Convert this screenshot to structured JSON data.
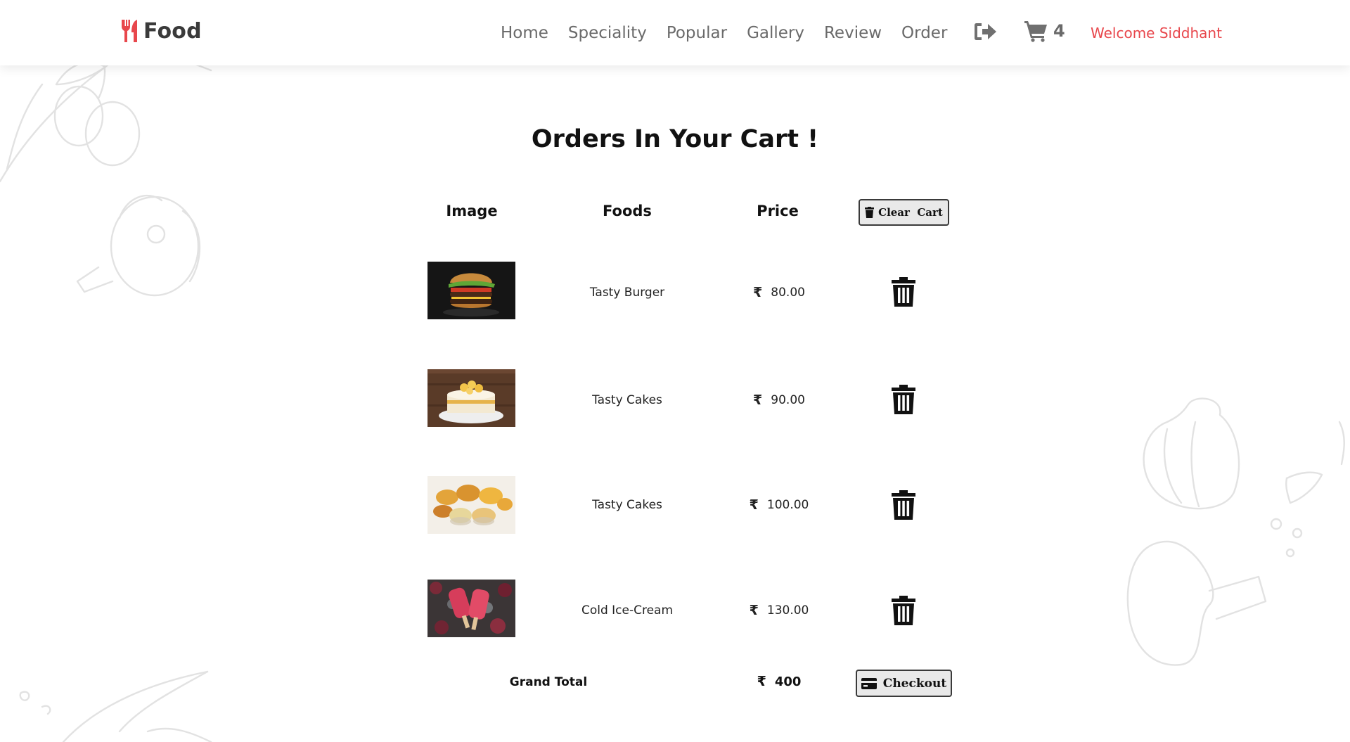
{
  "header": {
    "brand": "Food",
    "brand_icon": "utensils-icon",
    "brand_color": "#e8474c",
    "nav": [
      "Home",
      "Speciality",
      "Popular",
      "Gallery",
      "Review",
      "Order"
    ],
    "logout_icon": "sign-out-icon",
    "cart_icon": "shopping-cart-icon",
    "cart_count": "4",
    "welcome": "Welcome Siddhant"
  },
  "page": {
    "title": "Orders In Your Cart !"
  },
  "table": {
    "headers": [
      "Image",
      "Foods",
      "Price"
    ],
    "clear_button": "Clear  Cart",
    "currency": "₹",
    "rows": [
      {
        "name": "Tasty Burger",
        "price": "80.00",
        "image": "burger"
      },
      {
        "name": "Tasty Cakes",
        "price": "90.00",
        "image": "cake"
      },
      {
        "name": "Tasty Cakes",
        "price": "100.00",
        "image": "pastries"
      },
      {
        "name": "Cold Ice-Cream",
        "price": "130.00",
        "image": "ice-cream"
      }
    ],
    "grand_total_label": "Grand Total",
    "grand_total": "400",
    "checkout_button": "Checkout"
  },
  "colors": {
    "accent": "#e8474c",
    "nav_text": "#6a6a6a",
    "button_bg": "#e9e9e9"
  }
}
